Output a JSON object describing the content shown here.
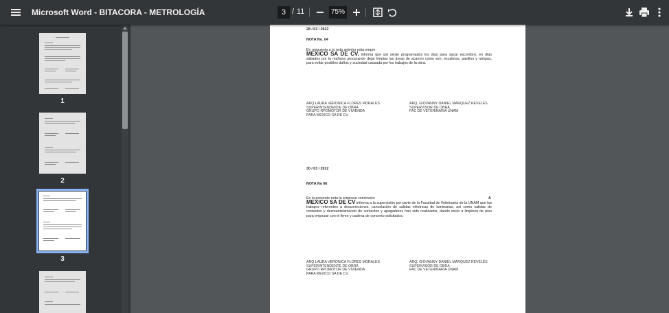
{
  "toolbar": {
    "title": "Microsoft Word - BITACORA - METROLOGÍA",
    "page_current": "3",
    "page_sep": "/",
    "page_total": "11",
    "zoom": "75%"
  },
  "icons": {
    "menu": "menu-icon",
    "fit": "fit-page-icon",
    "rotate": "rotate-icon",
    "download": "download-icon",
    "print": "print-icon",
    "more": "more-vert-icon"
  },
  "colors": {
    "toolbar": "#323639",
    "viewer": "#525659",
    "selected": "#8ab4f8"
  },
  "thumbnails": [
    {
      "label": "1"
    },
    {
      "label": "2"
    },
    {
      "label": "3"
    }
  ],
  "page": {
    "note1": {
      "date": "28 / 03 / 2022",
      "title": "NOTA No. 04",
      "intro": "En respuesta a la nota anterior esta empre",
      "company": "MEXICO SA DE CV.",
      "body": "informa que así serán programados los días para sacar escombro, en días sábados por la mañana procurando dejar limpias las áreas de acarreo como son, escaleras, pasillos y rampas, para evitar posibles daños y suciedad causada por los trabajos de la obra."
    },
    "note2": {
      "date": "30 / 03 / 2022",
      "title": "NOTA No 06",
      "intro": "En la presente nota la empresa constructo",
      "intro_end": "A",
      "company": "MEXICO SA DE CV",
      "body": "informa a la supervisión por parte de la Facultad de Veterinaria de la UNAM que los trabajos referentes a desconexiones, cancelación de salidas eléctricas de luminarias, así como salidas de contactos y desmantelamiento de contactos y apagadores han sido realizados, dando inicio a limpieza de piso para empezar con el firme y cadena de concreto solicitados."
    },
    "signature_left": [
      "ARQ LAURA VERONICA FLORES MORALES",
      "SUPERINTENDENTE DE OBRA",
      "GRUPO RPOMOTOR DE VIVIENDA",
      "PARA MEXICO SA DE CV."
    ],
    "signature_right": [
      "ARQ. GIOVANNY DANIEL MARQUEZ REVELES",
      "SUPERVISOR DE OBRA",
      "FAC DE VETERINARIA UNAM"
    ]
  }
}
